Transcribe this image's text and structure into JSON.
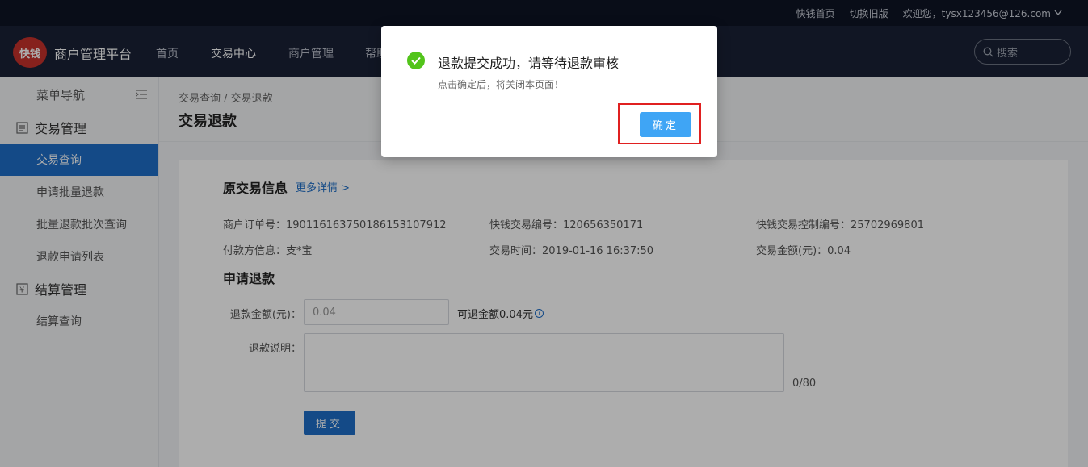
{
  "topbar": {
    "home_link": "快钱首页",
    "switch_link": "切换旧版",
    "welcome": "欢迎您，tysx123456@126.com"
  },
  "navbar": {
    "logo_text": "快钱",
    "brand": "商户管理平台",
    "items": [
      "首页",
      "交易中心",
      "商户管理",
      "帮助"
    ],
    "search_placeholder": "搜索"
  },
  "sidebar": {
    "header": "菜单导航",
    "groups": [
      {
        "label": "交易管理",
        "items": [
          "交易查询",
          "申请批量退款",
          "批量退款批次查询",
          "退款申请列表"
        ]
      },
      {
        "label": "结算管理",
        "items": [
          "结算查询"
        ]
      }
    ]
  },
  "content": {
    "breadcrumb": "交易查询 / 交易退款",
    "title": "交易退款"
  },
  "original_txn": {
    "section_title": "原交易信息",
    "more_link": "更多详情 >",
    "merchant_order": "商户订单号：190116163750186153107912",
    "kq_txn_no": "快钱交易编号：120656350171",
    "kq_ctrl_no": "快钱交易控制编号：25702969801",
    "payer": "付款方信息：支*宝",
    "txn_time": "交易时间：2019-01-16 16:37:50",
    "txn_amount": "交易金额(元)：0.04"
  },
  "refund_form": {
    "section_title": "申请退款",
    "amount_label": "退款金额(元)：",
    "amount_value": "0.04",
    "refundable_text": "可退金额0.04元",
    "desc_label": "退款说明：",
    "desc_counter": "0/80",
    "submit_label": "提交"
  },
  "modal": {
    "title": "退款提交成功，请等待退款审核",
    "subtitle": "点击确定后，将关闭本页面！",
    "confirm_label": "确定"
  }
}
